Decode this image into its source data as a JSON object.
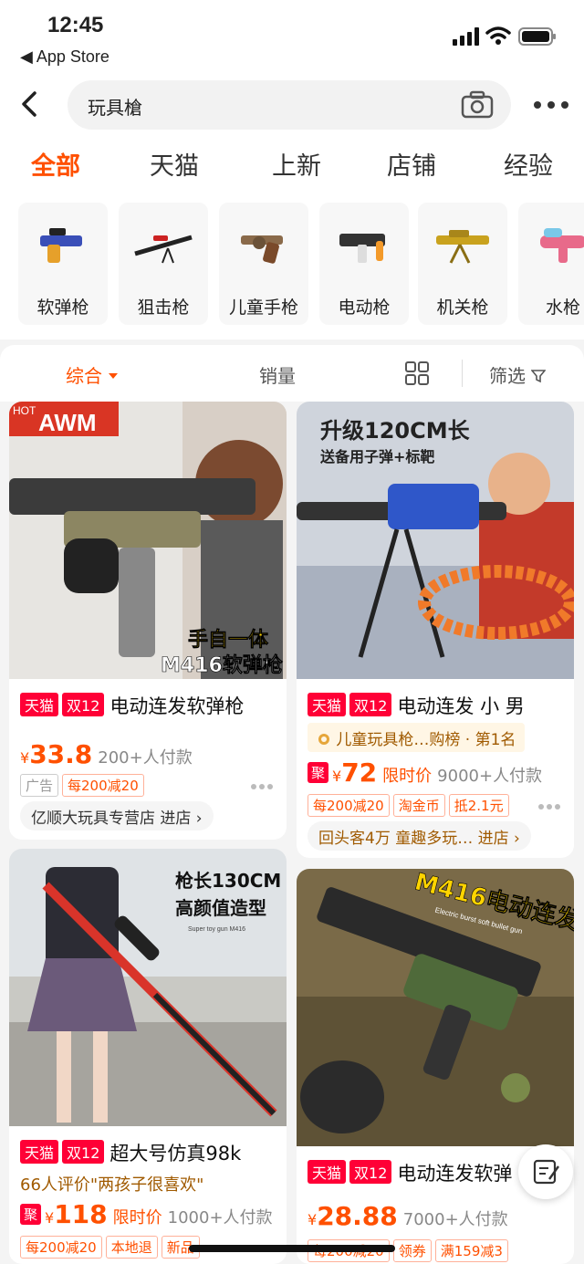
{
  "status_bar": {
    "time": "12:45",
    "back_app": "◀ App Store"
  },
  "search": {
    "query": "玩具槍"
  },
  "tabs": [
    "全部",
    "天猫",
    "上新",
    "店铺",
    "经验"
  ],
  "categories": [
    "软弹枪",
    "狙击枪",
    "儿童手枪",
    "电动枪",
    "机关枪",
    "水枪"
  ],
  "sort": {
    "comprehensive": "综合",
    "sales": "销量",
    "filter": "筛选"
  },
  "badges": {
    "tmall": "天猫",
    "double12": "双12",
    "ju": "聚",
    "yen": "¥"
  },
  "products": [
    {
      "overlay_top": "AWM",
      "overlay_hot": "HOT",
      "overlay_bottom_1": "手自一体",
      "overlay_bottom_2": "M416软弹枪",
      "title": "电动连发软弹枪",
      "price": "33.8",
      "paid": "200+人付款",
      "chips": [
        "广告",
        "每200减20"
      ],
      "store": "亿顺大玩具专营店 进店 ›"
    },
    {
      "overlay_top_1": "升级120CM长",
      "overlay_top_2": "送备用子弹+标靶",
      "title": "电动连发 小 男",
      "rank": "儿童玩具枪…购榜 · 第1名",
      "price": "72",
      "limit": "限时价",
      "paid": "9000+人付款",
      "chips": [
        "每200减20",
        "淘金币",
        "抵2.1元"
      ],
      "store": "回头客4万 童趣多玩… 进店 ›"
    },
    {
      "overlay_top_1": "枪长130CM",
      "overlay_top_2": "高颜值造型",
      "overlay_small": "Super toy gun M416",
      "title": "超大号仿真98k",
      "review": "66人评价\"两孩子很喜欢\"",
      "price": "118",
      "limit": "限时价",
      "paid": "1000+人付款",
      "chips": [
        "每200减20",
        "本地退",
        "新品"
      ]
    },
    {
      "overlay_top": "M416电动连发",
      "overlay_small": "Electric burst soft bullet gun",
      "title": "电动连发软弹",
      "price": "28.88",
      "paid": "7000+人付款",
      "chips": [
        "每200减20",
        "领券",
        "满159减3"
      ]
    }
  ],
  "colors": {
    "accent": "#ff5000",
    "tmall_red": "#ff0036",
    "background": "#f4f4f4"
  }
}
